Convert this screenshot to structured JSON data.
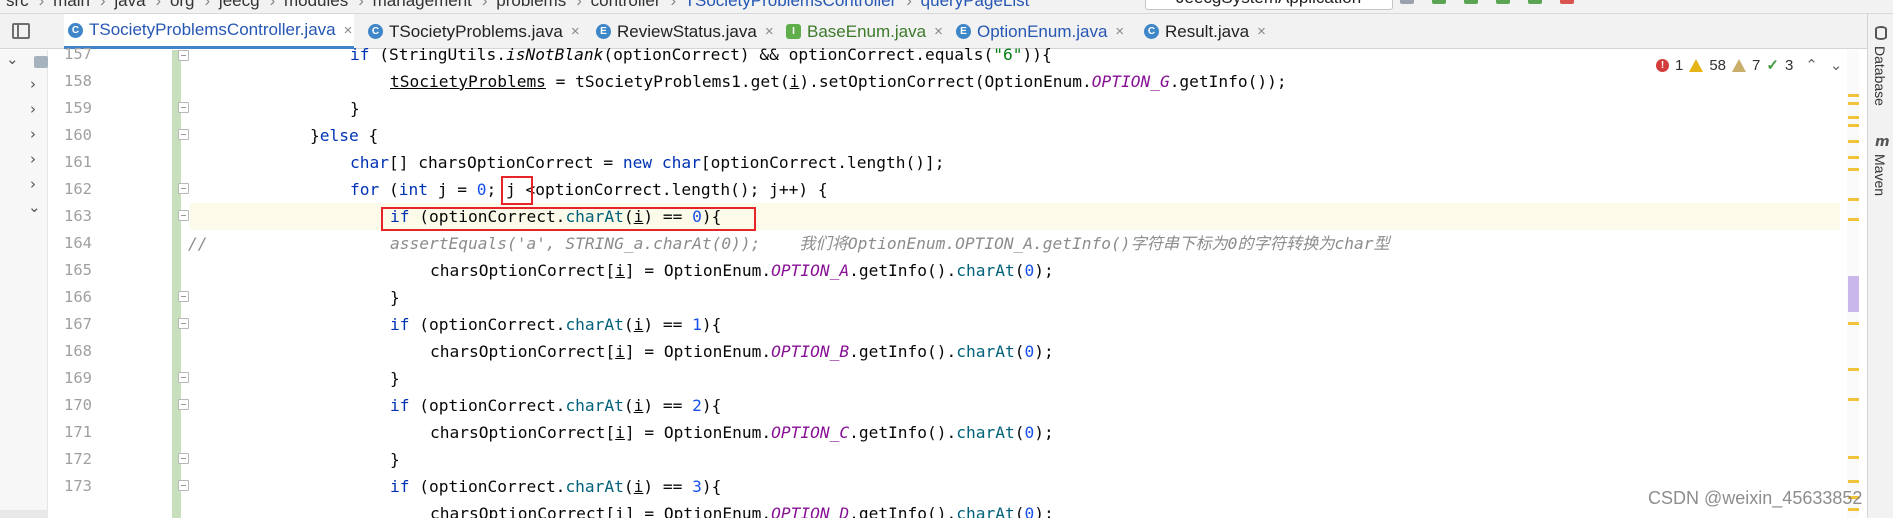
{
  "breadcrumb": {
    "items": [
      "src",
      "main",
      "java",
      "org",
      "jeecg",
      "modules",
      "management",
      "problems",
      "controller",
      "TSocietyProblemsController",
      "queryPageList"
    ]
  },
  "run_config": {
    "label": "JeecgSystemApplication"
  },
  "tabs": [
    {
      "label": "TSocietyProblemsController.java",
      "icon": "class-icon",
      "active": true,
      "color": "#2657b4"
    },
    {
      "label": "TSocietyProblems.java",
      "icon": "class-icon",
      "active": false,
      "color": "#222222"
    },
    {
      "label": "ReviewStatus.java",
      "icon": "enum-icon",
      "active": false,
      "color": "#222222"
    },
    {
      "label": "BaseEnum.java",
      "icon": "interface-icon",
      "active": false,
      "color": "#3c7a2a"
    },
    {
      "label": "OptionEnum.java",
      "icon": "enum-icon",
      "active": false,
      "color": "#2657b4"
    },
    {
      "label": "Result.java",
      "icon": "class-icon",
      "active": false,
      "color": "#222222"
    }
  ],
  "tab_close_glyph": "×",
  "line_numbers": [
    "157",
    "158",
    "159",
    "160",
    "161",
    "162",
    "163",
    "164",
    "165",
    "166",
    "167",
    "168",
    "169",
    "170",
    "171",
    "172",
    "173"
  ],
  "gutter_comment": "//",
  "inspections": {
    "errors": "1",
    "warnings": "58",
    "weak_warnings": "7",
    "ok": "3"
  },
  "right_panels": {
    "database": "Database",
    "maven": "Maven"
  },
  "watermark": "CSDN @weixin_45633852",
  "colors": {
    "keyword": "#0033b3",
    "field": "#871094",
    "number": "#1750eb",
    "comment": "#8c8c8c",
    "annotation_box": "#e8242b",
    "current_line": "#fcfae8"
  }
}
